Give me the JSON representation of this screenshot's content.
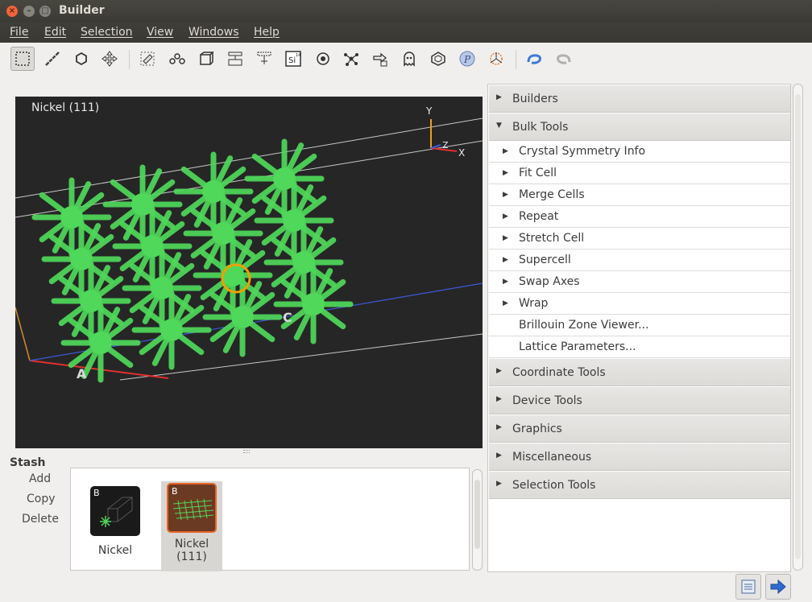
{
  "window": {
    "title": "Builder"
  },
  "menu": [
    "File",
    "Edit",
    "Selection",
    "View",
    "Windows",
    "Help"
  ],
  "toolbar": {
    "icons": [
      "select-icon",
      "ruler-icon",
      "hexagon-icon",
      "move-icon",
      "tag-icon",
      "bond-chain-icon",
      "cube-icon",
      "cleave-icon",
      "slab-icon",
      "element-icon",
      "atom-icon",
      "molecule-icon",
      "export-icon",
      "ghost-icon",
      "rotate-cube-icon",
      "python-icon",
      "axes-icon",
      "undo-icon",
      "redo-icon"
    ],
    "element_symbol": "Si",
    "element_number": "14"
  },
  "viewport": {
    "title": "Nickel (111)",
    "axis_labels": {
      "y": "Y",
      "z": "Z",
      "x": "X"
    },
    "cell_labels": {
      "a": "A",
      "c": "C"
    },
    "atom_color": "#4fd85a",
    "selection_color": "#f0a000"
  },
  "stash": {
    "title": "Stash",
    "actions": {
      "add": "Add",
      "copy": "Copy",
      "delete": "Delete"
    },
    "items": [
      {
        "badge": "B",
        "label": "Nickel"
      },
      {
        "badge": "B",
        "label": "Nickel (111)"
      }
    ]
  },
  "panel": {
    "sections": [
      {
        "label": "Builders",
        "expanded": false
      },
      {
        "label": "Bulk Tools",
        "expanded": true
      },
      {
        "label": "Coordinate Tools",
        "expanded": false
      },
      {
        "label": "Device Tools",
        "expanded": false
      },
      {
        "label": "Graphics",
        "expanded": false
      },
      {
        "label": "Miscellaneous",
        "expanded": false
      },
      {
        "label": "Selection Tools",
        "expanded": false
      }
    ],
    "bulk_tools": [
      {
        "label": "Crystal Symmetry Info",
        "arrow": true
      },
      {
        "label": "Fit Cell",
        "arrow": true
      },
      {
        "label": "Merge Cells",
        "arrow": true
      },
      {
        "label": "Repeat",
        "arrow": true
      },
      {
        "label": "Stretch Cell",
        "arrow": true
      },
      {
        "label": "Supercell",
        "arrow": true
      },
      {
        "label": "Swap Axes",
        "arrow": true
      },
      {
        "label": "Wrap",
        "arrow": true
      },
      {
        "label": "Brillouin Zone Viewer...",
        "arrow": false
      },
      {
        "label": "Lattice Parameters...",
        "arrow": false
      }
    ]
  },
  "statusbar": {
    "buttons": [
      "notes-icon",
      "send-to-icon"
    ]
  }
}
